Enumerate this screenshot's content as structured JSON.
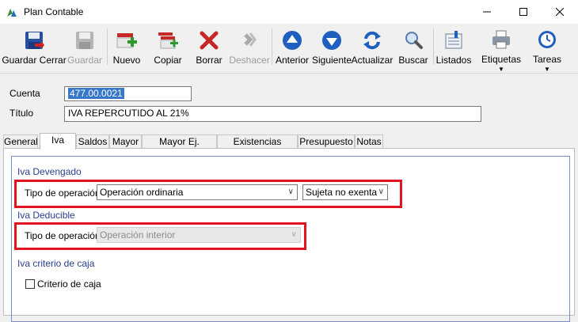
{
  "window": {
    "title": "Plan Contable"
  },
  "toolbar": {
    "guardar_cerrar": "Guardar Cerrar",
    "guardar": "Guardar",
    "nuevo": "Nuevo",
    "copiar": "Copiar",
    "borrar": "Borrar",
    "deshacer": "Deshacer",
    "anterior": "Anterior",
    "siguiente": "Siguiente",
    "actualizar": "Actualizar",
    "buscar": "Buscar",
    "listados": "Listados",
    "etiquetas": "Etiquetas",
    "tareas": "Tareas"
  },
  "form": {
    "cuenta_label": "Cuenta",
    "cuenta_value": "477.00.0021",
    "titulo_label": "Título",
    "titulo_value": "IVA REPERCUTIDO AL 21%"
  },
  "tabs": [
    "General",
    "Iva",
    "Saldos",
    "Mayor",
    "Mayor Ej. Anterior",
    "Existencias Finales",
    "Presupuesto",
    "Notas"
  ],
  "iva_tab": {
    "devengado_title": "Iva Devengado",
    "devengado_tipo_label": "Tipo de operación",
    "devengado_tipo_value": "Operación ordinaria",
    "devengado_sujeta_value": "Sujeta no exenta",
    "deducible_title": "Iva Deducible",
    "deducible_tipo_label": "Tipo de operación",
    "deducible_tipo_value": "Operación interior",
    "caja_title": "Iva criterio de caja",
    "caja_checkbox_label": "Criterio de caja",
    "caja_checked": false
  },
  "colors": {
    "accent": "#1f5fbf",
    "highlight_box": "#e0141e",
    "section_title": "#2a3f8f"
  }
}
